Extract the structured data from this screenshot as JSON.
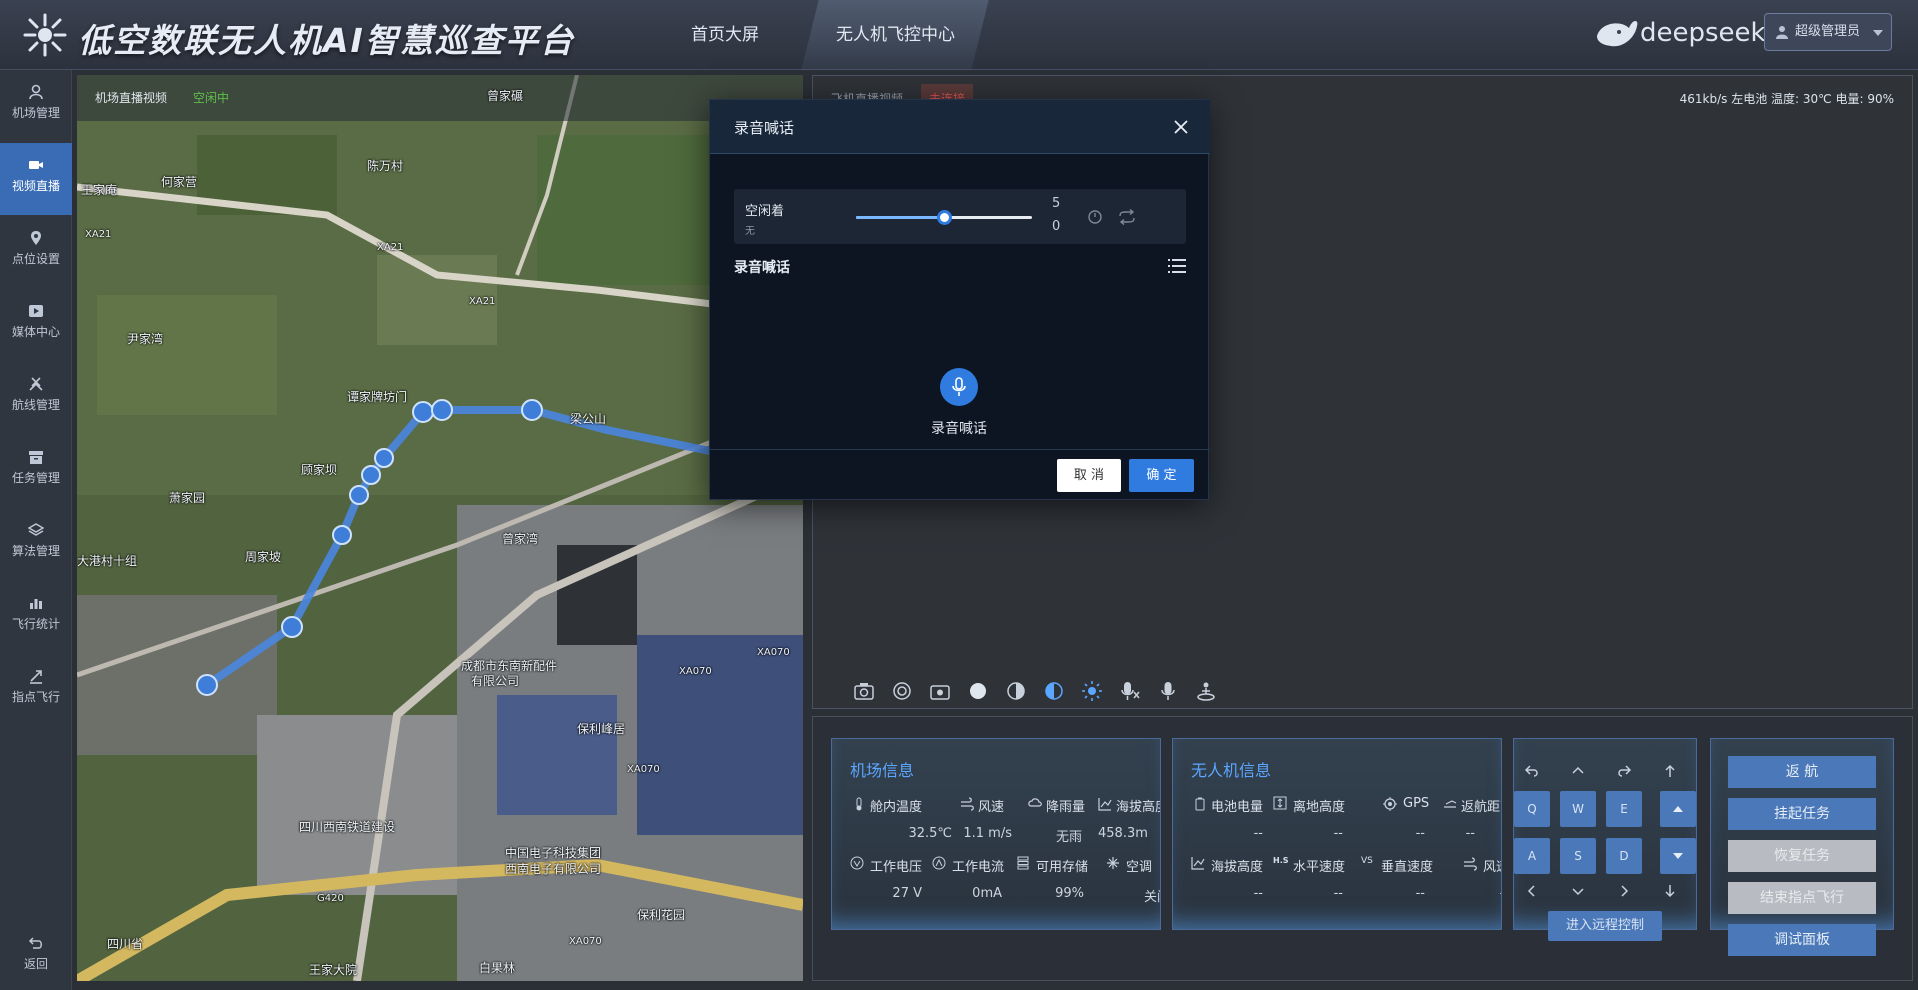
{
  "header": {
    "title": "低空数联无人机AI智慧巡查平台",
    "nav": [
      "首页大屏",
      "无人机飞控中心"
    ],
    "brand": "deepseek",
    "user": "超级管理员"
  },
  "sidebar": {
    "items": [
      {
        "label": "机场管理",
        "icon": "user-icon"
      },
      {
        "label": "视频直播",
        "icon": "camera-icon",
        "active": true
      },
      {
        "label": "点位设置",
        "icon": "location-pin-icon"
      },
      {
        "label": "媒体中心",
        "icon": "media-icon"
      },
      {
        "label": "航线管理",
        "icon": "route-icon"
      },
      {
        "label": "任务管理",
        "icon": "task-box-icon"
      },
      {
        "label": "算法管理",
        "icon": "layers-icon"
      },
      {
        "label": "飞行统计",
        "icon": "bar-chart-icon"
      },
      {
        "label": "指点飞行",
        "icon": "pointer-flight-icon"
      }
    ],
    "back": "返回"
  },
  "map": {
    "label": "机场直播视频",
    "status": "空闲中",
    "places": [
      "曾家碾",
      "陈万村",
      "王家庵",
      "何家营",
      "XA21",
      "XA21",
      "XA21",
      "尹家湾",
      "谭家牌坊门",
      "梁公山",
      "曾家湾",
      "萧家园",
      "周家坡",
      "大港村十组",
      "顾家坝",
      "成都市东南新配件",
      "有限公司",
      "XA070",
      "保利峰居",
      "XA070",
      "XA070",
      "四川西南铁道建设",
      "中国电子科技集团",
      "西南电子有限公司",
      "保利花园",
      "王家大院",
      "四川省",
      "白果林",
      "XA070",
      "G420"
    ]
  },
  "video": {
    "label": "飞机直播视频",
    "status": "未连接",
    "stats": "461kb/s   左电池  温度: 30℃  电量: 90%"
  },
  "airport_info": {
    "title": "机场信息",
    "row1": [
      {
        "label": "舱内温度",
        "value": "32.5℃"
      },
      {
        "label": "风速",
        "value": "1.1 m/s"
      },
      {
        "label": "降雨量",
        "value": "无雨"
      },
      {
        "label": "海拔高度",
        "value": "458.3m"
      }
    ],
    "row2": [
      {
        "label": "工作电压",
        "value": "27 V"
      },
      {
        "label": "工作电流",
        "value": "0mA"
      },
      {
        "label": "可用存储",
        "value": "99%"
      },
      {
        "label": "空调",
        "value": "关闭"
      }
    ]
  },
  "drone_info": {
    "title": "无人机信息",
    "row1": [
      {
        "label": "电池电量",
        "value": "--"
      },
      {
        "label": "离地高度",
        "value": "--"
      },
      {
        "label": "GPS",
        "value": "--"
      },
      {
        "label": "返航距离",
        "value": "--"
      }
    ],
    "row2": [
      {
        "label": "海拔高度",
        "value": "--"
      },
      {
        "label": "水平速度",
        "value": "--"
      },
      {
        "label": "垂直速度",
        "value": "--"
      },
      {
        "label": "风速",
        "value": "--"
      }
    ],
    "hs_abbr": "H.S",
    "vs_abbr": "VS"
  },
  "controls": {
    "keys": [
      "Q",
      "W",
      "E",
      "A",
      "S",
      "D"
    ],
    "remote": "进入远程控制"
  },
  "actions": [
    "返 航",
    "挂起任务",
    "恢复任务",
    "结束指点飞行",
    "调试面板"
  ],
  "dialog": {
    "title": "录音喊话",
    "player_name": "空闲着",
    "player_sub": "无",
    "volume_top": "5",
    "volume_bottom": "0",
    "slider_level": 0.5,
    "section_title": "录音喊话",
    "mic_label": "录音喊话",
    "cancel": "取 消",
    "ok": "确 定"
  },
  "colors": {
    "accent": "#2f7be0",
    "info_title": "#5ba6ff",
    "status_idle": "#5fbf4a",
    "status_error": "#e05555"
  }
}
